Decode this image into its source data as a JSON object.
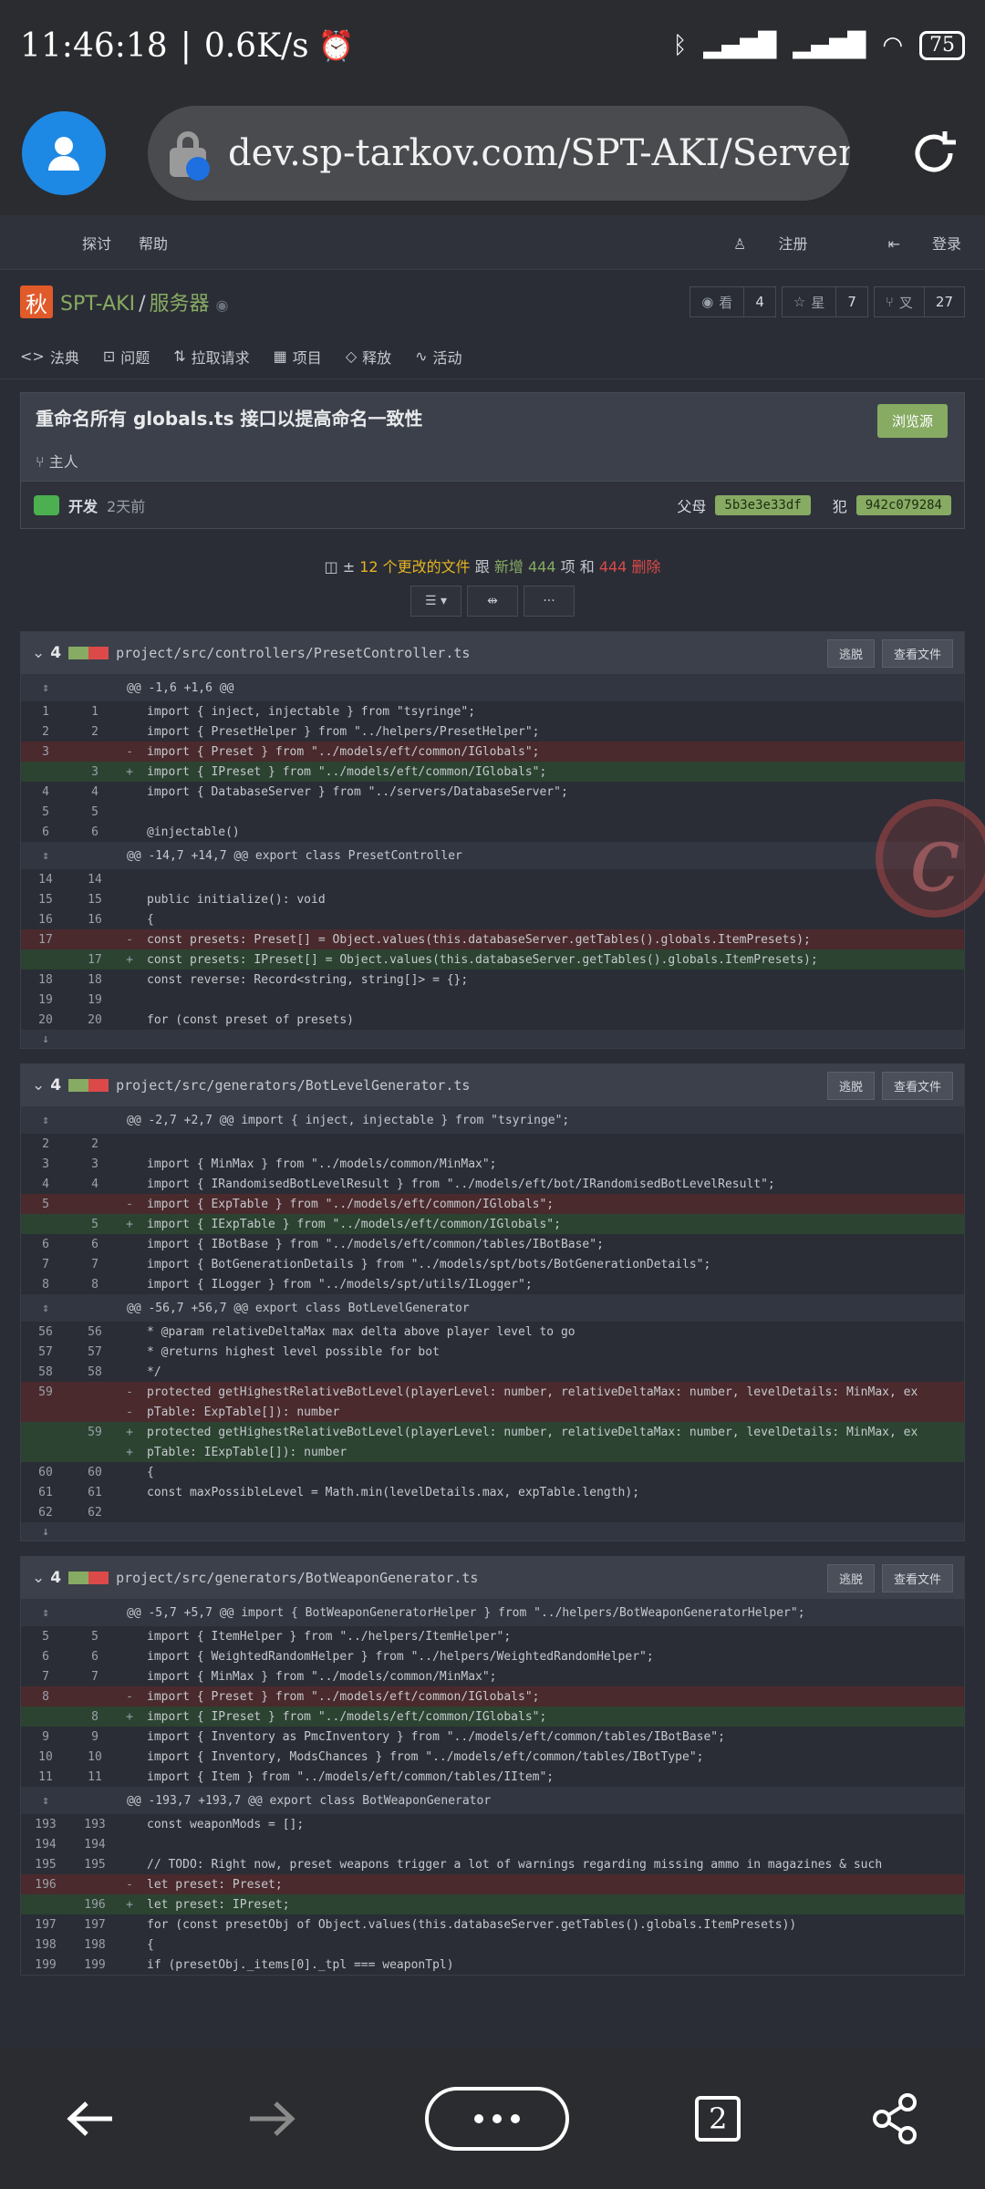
{
  "status": {
    "time": "11:46:18",
    "speed": "0.6K/s",
    "battery": "75"
  },
  "browser": {
    "url": "dev.sp-tarkov.com/SPT-AKI/Server/",
    "tab_count": "2"
  },
  "topnav": {
    "explore": "探讨",
    "help": "帮助",
    "register": "注册",
    "login": "登录"
  },
  "repo": {
    "icon_char": "秋",
    "owner": "SPT-AKI",
    "name": "服务器",
    "watch_label": "看",
    "watch": "4",
    "star_label": "星",
    "star": "7",
    "fork_label": "叉",
    "fork": "27"
  },
  "tabs": [
    "法典",
    "问题",
    "拉取请求",
    "项目",
    "释放",
    "活动"
  ],
  "commit": {
    "title": "重命名所有 globals.ts 接口以提高命名一致性",
    "browse": "浏览源",
    "branch": "主人",
    "author": "开发",
    "when": "2天前",
    "parent_label": "父母",
    "parent_sha": "5b3e3e33df",
    "commit_label": "犯",
    "commit_sha": "942c079284"
  },
  "summary": {
    "files": "12 个更改的文件",
    "mid": "跟",
    "add_label": "新增",
    "add": "444",
    "mid2": "项 和",
    "del": "444",
    "del_label": "删除"
  },
  "file_buttons": {
    "escape": "逃脱",
    "view": "查看文件"
  },
  "files": [
    {
      "count": "4",
      "path": "project/src/controllers/PresetController.ts",
      "rows": [
        {
          "t": "hunk",
          "c": "@@ -1,6 +1,6 @@"
        },
        {
          "t": "ctx",
          "o": "1",
          "n": "1",
          "c": "import { inject, injectable } from \"tsyringe\";"
        },
        {
          "t": "ctx",
          "o": "2",
          "n": "2",
          "c": "import { PresetHelper } from \"../helpers/PresetHelper\";"
        },
        {
          "t": "del",
          "o": "3",
          "n": "",
          "c": "import { Preset } from \"../models/eft/common/IGlobals\";"
        },
        {
          "t": "add",
          "o": "",
          "n": "3",
          "c": "import { IPreset } from \"../models/eft/common/IGlobals\";"
        },
        {
          "t": "ctx",
          "o": "4",
          "n": "4",
          "c": "import { DatabaseServer } from \"../servers/DatabaseServer\";"
        },
        {
          "t": "ctx",
          "o": "5",
          "n": "5",
          "c": ""
        },
        {
          "t": "ctx",
          "o": "6",
          "n": "6",
          "c": "@injectable()"
        },
        {
          "t": "hunk",
          "c": "@@ -14,7 +14,7 @@ export class PresetController"
        },
        {
          "t": "ctx",
          "o": "14",
          "n": "14",
          "c": ""
        },
        {
          "t": "ctx",
          "o": "15",
          "n": "15",
          "c": "    public initialize(): void"
        },
        {
          "t": "ctx",
          "o": "16",
          "n": "16",
          "c": "    {"
        },
        {
          "t": "del",
          "o": "17",
          "n": "",
          "c": "        const presets: Preset[] = Object.values(this.databaseServer.getTables().globals.ItemPresets);"
        },
        {
          "t": "add",
          "o": "",
          "n": "17",
          "c": "        const presets: IPreset[] = Object.values(this.databaseServer.getTables().globals.ItemPresets);"
        },
        {
          "t": "ctx",
          "o": "18",
          "n": "18",
          "c": "        const reverse: Record<string, string[]> = {};"
        },
        {
          "t": "ctx",
          "o": "19",
          "n": "19",
          "c": ""
        },
        {
          "t": "ctx",
          "o": "20",
          "n": "20",
          "c": "        for (const preset of presets)"
        },
        {
          "t": "exp",
          "c": ""
        }
      ]
    },
    {
      "count": "4",
      "path": "project/src/generators/BotLevelGenerator.ts",
      "rows": [
        {
          "t": "hunk",
          "c": "@@ -2,7 +2,7 @@ import { inject, injectable } from \"tsyringe\";"
        },
        {
          "t": "ctx",
          "o": "2",
          "n": "2",
          "c": ""
        },
        {
          "t": "ctx",
          "o": "3",
          "n": "3",
          "c": "import { MinMax } from \"../models/common/MinMax\";"
        },
        {
          "t": "ctx",
          "o": "4",
          "n": "4",
          "c": "import { IRandomisedBotLevelResult } from \"../models/eft/bot/IRandomisedBotLevelResult\";"
        },
        {
          "t": "del",
          "o": "5",
          "n": "",
          "c": "import { ExpTable } from \"../models/eft/common/IGlobals\";"
        },
        {
          "t": "add",
          "o": "",
          "n": "5",
          "c": "import { IExpTable } from \"../models/eft/common/IGlobals\";"
        },
        {
          "t": "ctx",
          "o": "6",
          "n": "6",
          "c": "import { IBotBase } from \"../models/eft/common/tables/IBotBase\";"
        },
        {
          "t": "ctx",
          "o": "7",
          "n": "7",
          "c": "import { BotGenerationDetails } from \"../models/spt/bots/BotGenerationDetails\";"
        },
        {
          "t": "ctx",
          "o": "8",
          "n": "8",
          "c": "import { ILogger } from \"../models/spt/utils/ILogger\";"
        },
        {
          "t": "hunk",
          "c": "@@ -56,7 +56,7 @@ export class BotLevelGenerator"
        },
        {
          "t": "ctx",
          "o": "56",
          "n": "56",
          "c": "     * @param relativeDeltaMax max delta above player level to go"
        },
        {
          "t": "ctx",
          "o": "57",
          "n": "57",
          "c": "     * @returns highest level possible for bot"
        },
        {
          "t": "ctx",
          "o": "58",
          "n": "58",
          "c": "     */"
        },
        {
          "t": "del",
          "o": "59",
          "n": "",
          "c": "    protected getHighestRelativeBotLevel(playerLevel: number, relativeDeltaMax: number, levelDetails: MinMax, ex"
        },
        {
          "t": "del",
          "o": "",
          "n": "",
          "c": "pTable: ExpTable[]): number"
        },
        {
          "t": "add",
          "o": "",
          "n": "59",
          "c": "    protected getHighestRelativeBotLevel(playerLevel: number, relativeDeltaMax: number, levelDetails: MinMax, ex"
        },
        {
          "t": "add",
          "o": "",
          "n": "",
          "c": "pTable: IExpTable[]): number"
        },
        {
          "t": "ctx",
          "o": "60",
          "n": "60",
          "c": "    {"
        },
        {
          "t": "ctx",
          "o": "61",
          "n": "61",
          "c": "        const maxPossibleLevel = Math.min(levelDetails.max, expTable.length);"
        },
        {
          "t": "ctx",
          "o": "62",
          "n": "62",
          "c": ""
        },
        {
          "t": "exp",
          "c": ""
        }
      ]
    },
    {
      "count": "4",
      "path": "project/src/generators/BotWeaponGenerator.ts",
      "rows": [
        {
          "t": "hunk",
          "c": "@@ -5,7 +5,7 @@ import { BotWeaponGeneratorHelper } from \"../helpers/BotWeaponGeneratorHelper\";"
        },
        {
          "t": "ctx",
          "o": "5",
          "n": "5",
          "c": "import { ItemHelper } from \"../helpers/ItemHelper\";"
        },
        {
          "t": "ctx",
          "o": "6",
          "n": "6",
          "c": "import { WeightedRandomHelper } from \"../helpers/WeightedRandomHelper\";"
        },
        {
          "t": "ctx",
          "o": "7",
          "n": "7",
          "c": "import { MinMax } from \"../models/common/MinMax\";"
        },
        {
          "t": "del",
          "o": "8",
          "n": "",
          "c": "import { Preset } from \"../models/eft/common/IGlobals\";"
        },
        {
          "t": "add",
          "o": "",
          "n": "8",
          "c": "import { IPreset } from \"../models/eft/common/IGlobals\";"
        },
        {
          "t": "ctx",
          "o": "9",
          "n": "9",
          "c": "import { Inventory as PmcInventory } from \"../models/eft/common/tables/IBotBase\";"
        },
        {
          "t": "ctx",
          "o": "10",
          "n": "10",
          "c": "import { Inventory, ModsChances } from \"../models/eft/common/tables/IBotType\";"
        },
        {
          "t": "ctx",
          "o": "11",
          "n": "11",
          "c": "import { Item } from \"../models/eft/common/tables/IItem\";"
        },
        {
          "t": "hunk",
          "c": "@@ -193,7 +193,7 @@ export class BotWeaponGenerator"
        },
        {
          "t": "ctx",
          "o": "193",
          "n": "193",
          "c": "        const weaponMods = [];"
        },
        {
          "t": "ctx",
          "o": "194",
          "n": "194",
          "c": ""
        },
        {
          "t": "ctx",
          "o": "195",
          "n": "195",
          "c": "        // TODO: Right now, preset weapons trigger a lot of warnings regarding missing ammo in magazines & such"
        },
        {
          "t": "del",
          "o": "196",
          "n": "",
          "c": "        let preset: Preset;"
        },
        {
          "t": "add",
          "o": "",
          "n": "196",
          "c": "        let preset: IPreset;"
        },
        {
          "t": "ctx",
          "o": "197",
          "n": "197",
          "c": "        for (const presetObj of Object.values(this.databaseServer.getTables().globals.ItemPresets))"
        },
        {
          "t": "ctx",
          "o": "198",
          "n": "198",
          "c": "        {"
        },
        {
          "t": "ctx",
          "o": "199",
          "n": "199",
          "c": "            if (presetObj._items[0]._tpl === weaponTpl)"
        }
      ]
    }
  ]
}
